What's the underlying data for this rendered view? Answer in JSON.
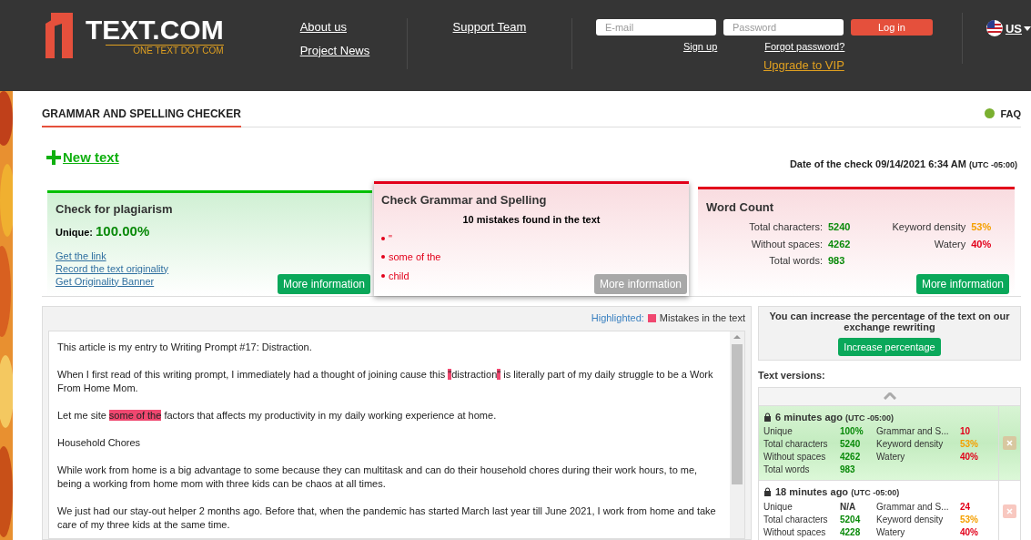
{
  "header": {
    "logo": {
      "name": "TEXT.COM",
      "tagline": "ONE TEXT DOT COM"
    },
    "nav": [
      [
        "About us",
        "Project News"
      ],
      [
        "Support Team"
      ]
    ],
    "login": {
      "email_placeholder": "E-mail",
      "password_placeholder": "Password",
      "button": "Log in",
      "sign_up": "Sign up",
      "forgot": "Forgot password?",
      "upgrade": "Upgrade to VIP"
    },
    "language": "US"
  },
  "page": {
    "title": "GRAMMAR AND SPELLING CHECKER",
    "faq": "FAQ",
    "new_text": "New text",
    "date": "Date of the check 09/14/2021 6:34 AM",
    "timezone": "(UTC -05:00)"
  },
  "plagiarism": {
    "title": "Check for plagiarism",
    "unique_label": "Unique:",
    "unique_value": "100.00%",
    "links": [
      "Get the link",
      "Record the text originality",
      "Get Originality Banner"
    ],
    "button": "More information",
    "button_disabled": false
  },
  "grammar": {
    "title": "Check Grammar and Spelling",
    "summary": "10 mistakes found in the text",
    "mistakes": [
      "\"",
      "some of the",
      "child"
    ],
    "button": "More information",
    "button_disabled": true
  },
  "word_count": {
    "title": "Word Count",
    "stats": [
      {
        "label": "Total characters:",
        "value": "5240"
      },
      {
        "label": "Without spaces:",
        "value": "4262"
      },
      {
        "label": "Total words:",
        "value": "983"
      }
    ],
    "metrics": [
      {
        "label": "Keyword density",
        "value": "53%",
        "color": "#f5a000"
      },
      {
        "label": "Watery",
        "value": "40%",
        "color": "#e2001a"
      }
    ],
    "button": "More information",
    "button_disabled": false
  },
  "text_panel": {
    "highlight_label": "Highlighted:",
    "legend": "Mistakes in the text",
    "paragraphs": [
      [
        {
          "text": "This article is my entry to Writing Prompt #17: Distraction.",
          "mistake": false
        }
      ],
      [
        {
          "text": "When I first read of this writing prompt, I immediately had a thought of joining cause this ",
          "mistake": false
        },
        {
          "text": "\"",
          "mistake": true
        },
        {
          "text": "distraction",
          "mistake": false
        },
        {
          "text": "\"",
          "mistake": true
        },
        {
          "text": " is literally part of my daily struggle to be a Work From Home Mom.",
          "mistake": false
        }
      ],
      [
        {
          "text": "Let me site ",
          "mistake": false
        },
        {
          "text": "some of the",
          "mistake": true
        },
        {
          "text": " factors that affects my productivity in my daily working experience at home.",
          "mistake": false
        }
      ],
      [
        {
          "text": "Household Chores",
          "mistake": false
        }
      ],
      [
        {
          "text": "While work from home is a big advantage to some because they can multitask and can do their household chores during their work hours, to me, being a working from home mom with three kids can be chaos at all times.",
          "mistake": false
        }
      ],
      [
        {
          "text": "We just had our stay-out helper 2 months ago. Before that, when the pandemic has started March last year till June 2021, I work from home and take care of my three kids at the same time.",
          "mistake": false
        }
      ]
    ]
  },
  "promo": {
    "text": "You can increase the percentage of the text on our exchange rewriting",
    "button": "Increase percentage"
  },
  "versions": {
    "title": "Text versions:",
    "items": [
      {
        "time": "6 minutes ago",
        "timezone": "(UTC -05:00)",
        "selected": true,
        "rows": [
          {
            "label": "Unique",
            "value": "100%",
            "label2": "Grammar and S...",
            "value2": "10"
          },
          {
            "label": "Total characters",
            "value": "5240",
            "label2": "Keyword density",
            "value2": "53%"
          },
          {
            "label": "Without spaces",
            "value": "4262",
            "label2": "Watery",
            "value2": "40%"
          },
          {
            "label": "Total words",
            "value": "983"
          }
        ]
      },
      {
        "time": "18 minutes ago",
        "timezone": "(UTC -05:00)",
        "selected": false,
        "rows": [
          {
            "label": "Unique",
            "value": "N/A",
            "label2": "Grammar and S...",
            "value2": "24"
          },
          {
            "label": "Total characters",
            "value": "5204",
            "label2": "Keyword density",
            "value2": "53%"
          },
          {
            "label": "Without spaces",
            "value": "4228",
            "label2": "Watery",
            "value2": "40%"
          }
        ]
      }
    ]
  }
}
